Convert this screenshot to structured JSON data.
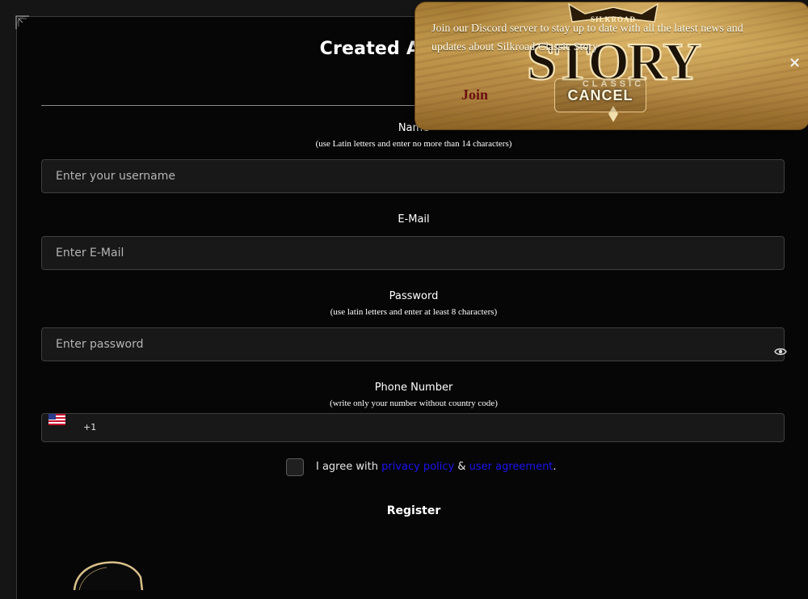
{
  "form": {
    "title": "Created Account",
    "name_label": "Name",
    "name_hint": "(use Latin letters and enter no more than 14 characters)",
    "username_placeholder": "Enter your username",
    "email_label": "E-Mail",
    "email_placeholder": "Enter E-Mail",
    "password_label": "Password",
    "password_hint": "(use latin letters and enter at least 8 characters)",
    "password_placeholder": "Enter password",
    "phone_label": "Phone Number",
    "phone_hint": "(write only your number without country code)",
    "phone_dial_code": "+1",
    "phone_country_icon": "us-flag-icon",
    "agree_prefix": "I agree with",
    "privacy_link": "privacy policy",
    "agree_and": "&",
    "agreement_link": "user agreement",
    "agree_suffix": ".",
    "register_label": "Register"
  },
  "popup": {
    "message": "Join our Discord server to stay up to date with all the latest news and updates about Silkroad Classic Story",
    "join_label": "Join",
    "cancel_label": "CANCEL",
    "close_glyph": "×",
    "logo": {
      "top_text": "SILKROAD",
      "main_text": "STORY",
      "sub_text": "CLASSIC"
    }
  },
  "colors": {
    "background": "#151515",
    "link": "#1a12ee",
    "popup_gold": "#b28642",
    "join_text": "#6a1010"
  }
}
